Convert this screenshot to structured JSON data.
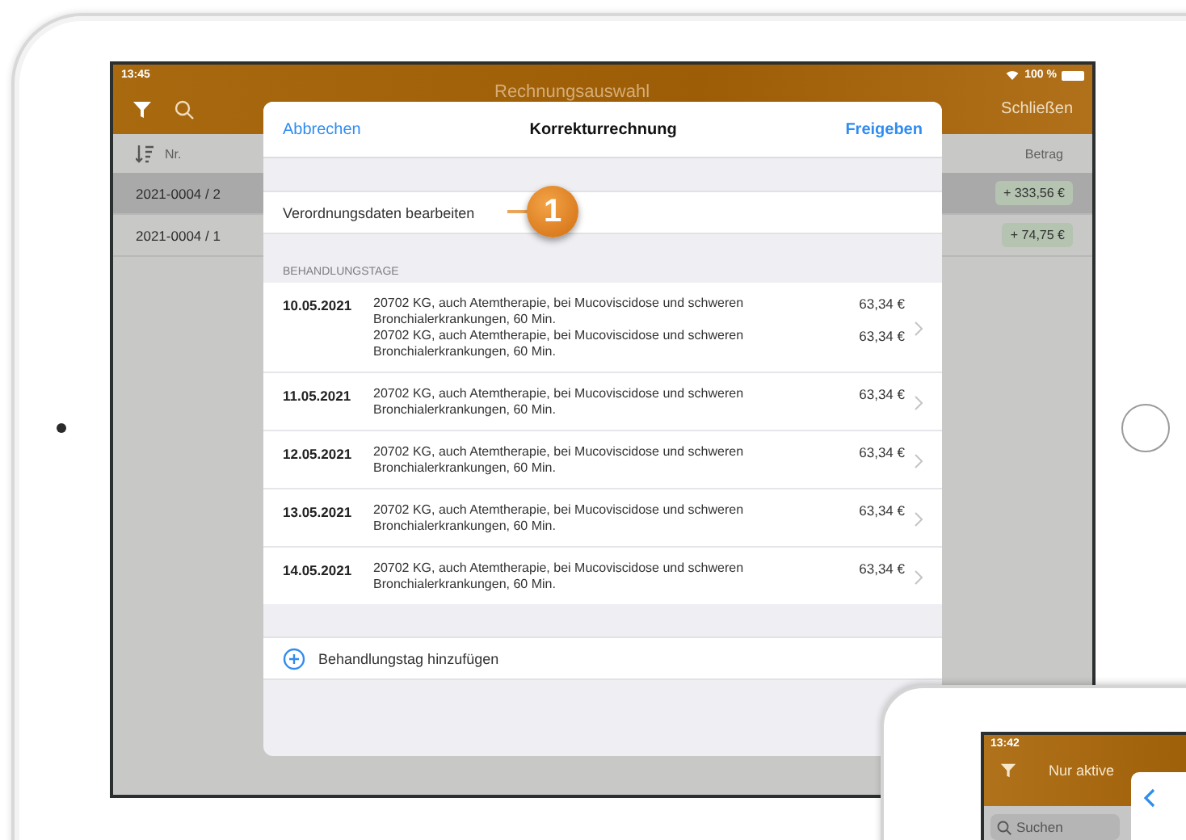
{
  "main_device": {
    "status_bar": {
      "time": "13:45",
      "battery": "100 %"
    },
    "nav_bar": {
      "title": "Rechnungsauswahl",
      "close": "Schließen"
    },
    "list_header": {
      "sort_label": "Nr.",
      "amount_label": "Betrag"
    },
    "invoices": [
      {
        "number": "2021-0004 / 2",
        "amount": "+ 333,56 €",
        "selected": true
      },
      {
        "number": "2021-0004 / 1",
        "amount": "+ 74,75 €",
        "selected": false
      }
    ],
    "modal": {
      "cancel": "Abbrechen",
      "title": "Korrekturrechnung",
      "confirm": "Freigeben",
      "edit_row": "Verordnungsdaten bearbeiten",
      "callout": "1",
      "section_header": "BEHANDLUNGSTAGE",
      "days": [
        {
          "date": "10.05.2021",
          "items": [
            {
              "description": "20702 KG, auch Atemtherapie, bei Mucoviscidose und schweren Bronchialerkrankungen, 60 Min.",
              "price": "63,34 €"
            },
            {
              "description": "20702 KG, auch Atemtherapie, bei Mucoviscidose und schweren Bronchialerkrankungen, 60 Min.",
              "price": "63,34 €"
            }
          ]
        },
        {
          "date": "11.05.2021",
          "items": [
            {
              "description": "20702 KG, auch Atemtherapie, bei Mucoviscidose und schweren Bronchialerkrankungen, 60 Min.",
              "price": "63,34 €"
            }
          ]
        },
        {
          "date": "12.05.2021",
          "items": [
            {
              "description": "20702 KG, auch Atemtherapie, bei Mucoviscidose und schweren Bronchialerkrankungen, 60 Min.",
              "price": "63,34 €"
            }
          ]
        },
        {
          "date": "13.05.2021",
          "items": [
            {
              "description": "20702 KG, auch Atemtherapie, bei Mucoviscidose und schweren Bronchialerkrankungen, 60 Min.",
              "price": "63,34 €"
            }
          ]
        },
        {
          "date": "14.05.2021",
          "items": [
            {
              "description": "20702 KG, auch Atemtherapie, bei Mucoviscidose und schweren Bronchialerkrankungen, 60 Min.",
              "price": "63,34 €"
            }
          ]
        }
      ],
      "add_row": "Behandlungstag hinzufügen"
    }
  },
  "second_device": {
    "status_bar": {
      "time": "13:42"
    },
    "nav_title": "Nur aktive",
    "search_placeholder": "Suchen"
  }
}
